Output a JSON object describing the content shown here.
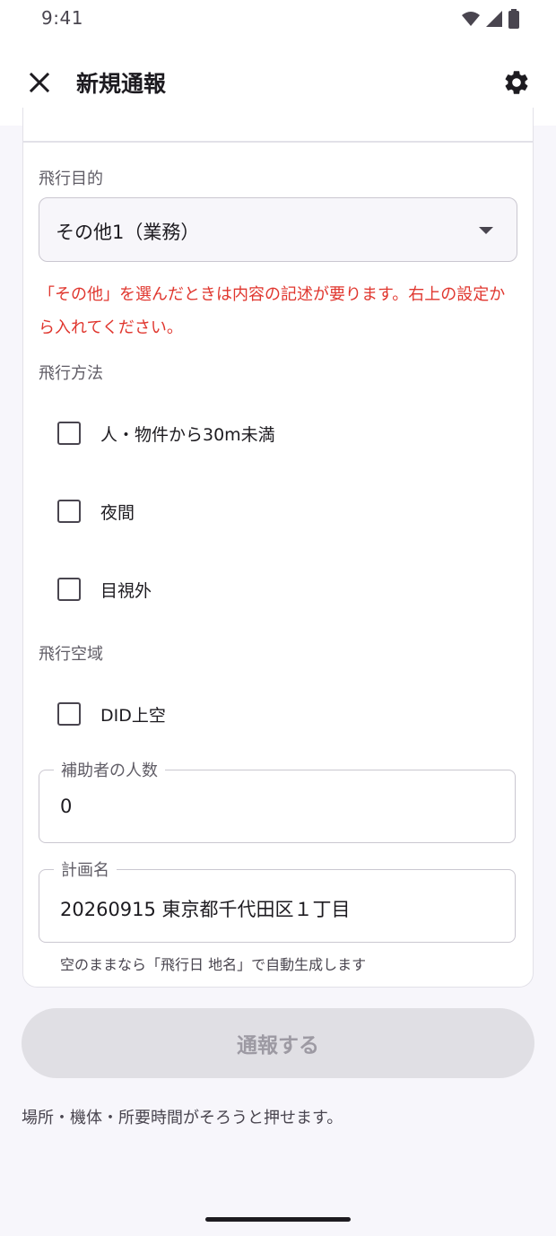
{
  "status_bar": {
    "time": "9:41",
    "icons": [
      "wifi-icon",
      "signal-icon",
      "battery-icon"
    ]
  },
  "app_bar": {
    "title": "新規通報",
    "close_icon": "close-icon",
    "settings_icon": "gear-icon"
  },
  "form": {
    "purpose": {
      "label": "飛行目的",
      "selected": "その他1（業務）"
    },
    "error_message": "「その他」を選んだときは内容の記述が要ります。右上の設定から入れてください。",
    "method": {
      "label": "飛行方法",
      "options": [
        {
          "label": "人・物件から30m未満",
          "checked": false
        },
        {
          "label": "夜間",
          "checked": false
        },
        {
          "label": "目視外",
          "checked": false
        }
      ]
    },
    "airspace": {
      "label": "飛行空域",
      "options": [
        {
          "label": "DID上空",
          "checked": false
        }
      ]
    },
    "assistants": {
      "label": "補助者の人数",
      "value": "0"
    },
    "plan_name": {
      "label": "計画名",
      "value": "20260915 東京都千代田区１丁目",
      "helper": "空のままなら「飛行日 地名」で自動生成します"
    }
  },
  "submit": {
    "label": "通報する",
    "enabled": false
  },
  "hint": "場所・機体・所要時間がそろうと押せます。",
  "colors": {
    "error": "#e0362e",
    "disabled_button_bg": "#e0dfe4",
    "disabled_button_text": "#9d9aa3"
  }
}
